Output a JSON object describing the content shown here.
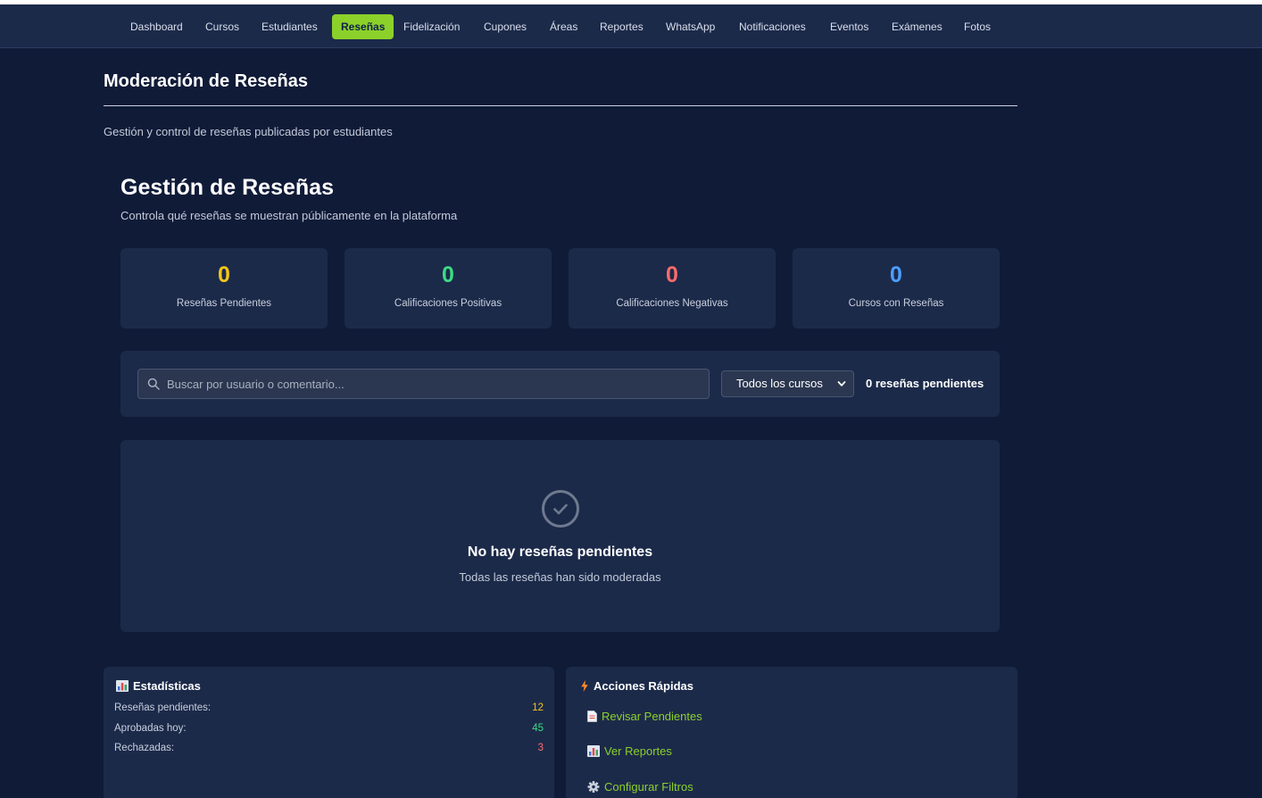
{
  "nav": {
    "items": [
      {
        "label": "Dashboard",
        "active": false
      },
      {
        "label": "Cursos",
        "active": false
      },
      {
        "label": "Estudiantes",
        "active": false
      },
      {
        "label": "Reseñas",
        "active": true
      },
      {
        "label": "Fidelización",
        "active": false
      },
      {
        "label": "Cupones",
        "active": false
      },
      {
        "label": "Áreas",
        "active": false
      },
      {
        "label": "Reportes",
        "active": false
      },
      {
        "label": "WhatsApp",
        "active": false
      },
      {
        "label": "Notificaciones",
        "active": false
      },
      {
        "label": "Eventos",
        "active": false
      },
      {
        "label": "Exámenes",
        "active": false
      },
      {
        "label": "Fotos",
        "active": false
      }
    ],
    "active_color": "#8bd12a"
  },
  "page": {
    "title": "Moderación de Reseñas",
    "subtitle": "Gestión y control de reseñas publicadas por estudiantes"
  },
  "section": {
    "title": "Gestión de Reseñas",
    "subtitle": "Controla qué reseñas se muestran públicamente en la plataforma"
  },
  "stats": [
    {
      "value": "0",
      "label": "Reseñas Pendientes",
      "color": "#f5c518"
    },
    {
      "value": "0",
      "label": "Calificaciones Positivas",
      "color": "#3ddc84"
    },
    {
      "value": "0",
      "label": "Calificaciones Negativas",
      "color": "#ff6b6b"
    },
    {
      "value": "0",
      "label": "Cursos con Reseñas",
      "color": "#4d9fff"
    }
  ],
  "filters": {
    "search_placeholder": "Buscar por usuario o comentario...",
    "search_value": "",
    "course_select": "Todos los cursos",
    "pending_text": "0 reseñas pendientes"
  },
  "empty": {
    "icon": "check-circle-icon",
    "title": "No hay reseñas pendientes",
    "subtitle": "Todas las reseñas han sido moderadas"
  },
  "estadisticas": {
    "title": "Estadísticas",
    "icon": "bar-chart-icon",
    "rows": [
      {
        "label": "Reseñas pendientes:",
        "value": "12",
        "color": "#f5c518"
      },
      {
        "label": "Aprobadas hoy:",
        "value": "45",
        "color": "#3ddc84"
      },
      {
        "label": "Rechazadas:",
        "value": "3",
        "color": "#ff6b6b"
      }
    ]
  },
  "acciones": {
    "title": "Acciones Rápidas",
    "icon": "lightning-icon",
    "items": [
      {
        "label": "Revisar Pendientes",
        "icon": "document-icon"
      },
      {
        "label": "Ver Reportes",
        "icon": "bar-chart-icon"
      },
      {
        "label": "Configurar Filtros",
        "icon": "gear-icon"
      }
    ]
  }
}
